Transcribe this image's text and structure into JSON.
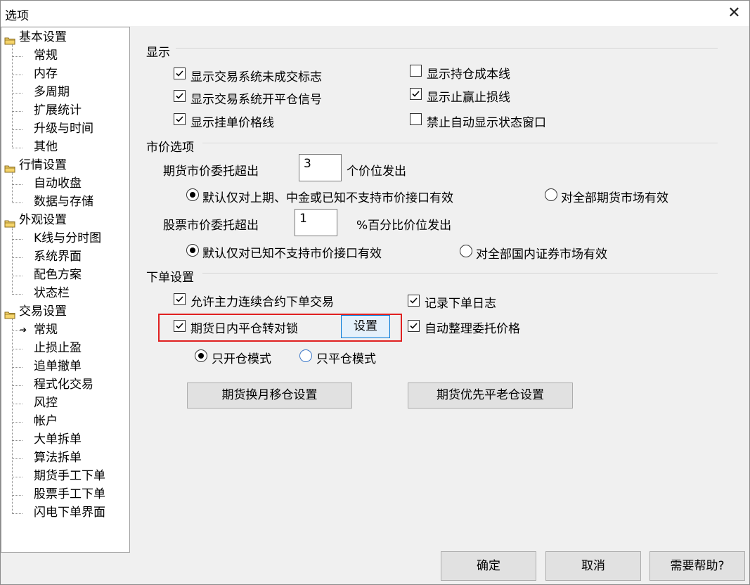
{
  "window": {
    "title": "选项",
    "close_glyph": "✕"
  },
  "tree": {
    "groups": [
      {
        "label": "基本设置",
        "children": [
          "常规",
          "内存",
          "多周期",
          "扩展统计",
          "升级与时间",
          "其他"
        ]
      },
      {
        "label": "行情设置",
        "children": [
          "自动收盘",
          "数据与存储"
        ]
      },
      {
        "label": "外观设置",
        "children": [
          "K线与分时图",
          "系统界面",
          "配色方案",
          "状态栏"
        ]
      },
      {
        "label": "交易设置",
        "children": [
          "常规",
          "止损止盈",
          "追单撤单",
          "程式化交易",
          "风控",
          "帐户",
          "大单拆单",
          "算法拆单",
          "期货手工下单",
          "股票手工下单",
          "闪电下单界面"
        ]
      }
    ],
    "selected": "交易设置/常规",
    "selected_marker": "➔"
  },
  "display": {
    "heading": "显示",
    "show_unfilled_mark": {
      "label": "显示交易系统未成交标志",
      "checked": true
    },
    "show_open_close_signal": {
      "label": "显示交易系统开平仓信号",
      "checked": true
    },
    "show_order_price_line": {
      "label": "显示挂单价格线",
      "checked": true
    },
    "show_position_cost_line": {
      "label": "显示持仓成本线",
      "checked": false
    },
    "show_tp_sl_line": {
      "label": "显示止赢止损线",
      "checked": true
    },
    "disable_auto_status_window": {
      "label": "禁止自动显示状态窗口",
      "checked": false
    }
  },
  "market_price": {
    "heading": "市价选项",
    "futures_prefix": "期货市价委托超出",
    "futures_value": "3",
    "futures_suffix": "个价位发出",
    "futures_radio_default": {
      "label": "默认仅对上期、中金或已知不支持市价接口有效",
      "selected": true
    },
    "futures_radio_all": {
      "label": "对全部期货市场有效",
      "selected": false
    },
    "stock_prefix": "股票市价委托超出",
    "stock_value": "1",
    "stock_suffix": "%百分比价位发出",
    "stock_radio_default": {
      "label": "默认仅对已知不支持市价接口有效",
      "selected": true
    },
    "stock_radio_all": {
      "label": "对全部国内证券市场有效",
      "selected": false
    }
  },
  "order": {
    "heading": "下单设置",
    "allow_main_continuous": {
      "label": "允许主力连续合约下单交易",
      "checked": true
    },
    "record_order_log": {
      "label": "记录下单日志",
      "checked": true
    },
    "intraday_close_to_lock": {
      "label": "期货日内平仓转对锁",
      "checked": true
    },
    "settings_button": "设置",
    "auto_arrange_price": {
      "label": "自动整理委托价格",
      "checked": true
    },
    "mode_open_only": {
      "label": "只开仓模式",
      "selected": true
    },
    "mode_close_only": {
      "label": "只平仓模式",
      "selected": false
    },
    "rollover_button": "期货换月移仓设置",
    "priority_close_button": "期货优先平老仓设置"
  },
  "footer": {
    "ok": "确定",
    "cancel": "取消",
    "help": "需要帮助?"
  }
}
